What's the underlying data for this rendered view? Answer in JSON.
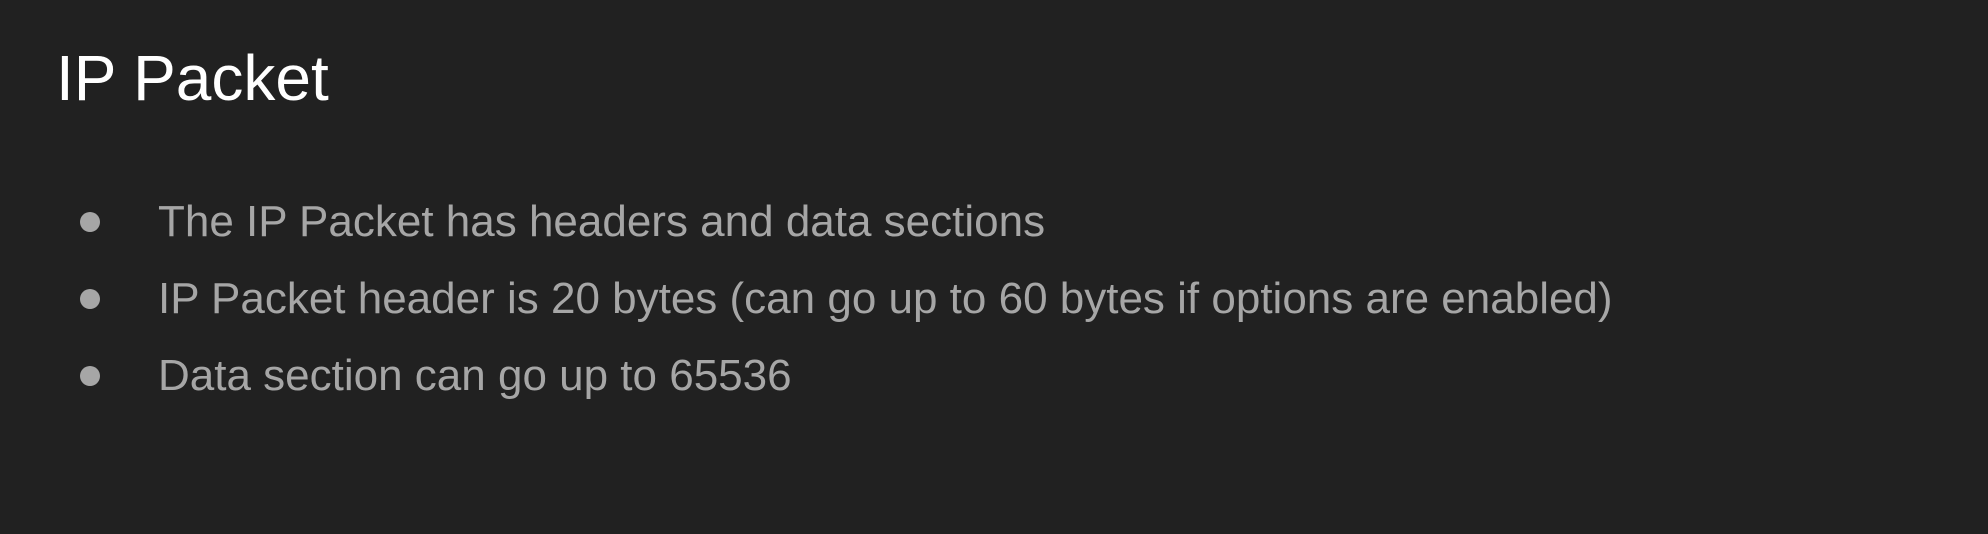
{
  "slide": {
    "title": "IP Packet",
    "bullets": [
      "The IP Packet has headers and data sections",
      "IP Packet header is 20 bytes (can go up to 60 bytes if options are enabled)",
      "Data section can go up to 65536"
    ]
  },
  "colors": {
    "background": "#212121",
    "title": "#ffffff",
    "bullet_text": "#a6a6a6",
    "bullet_dot": "#a6a6a6"
  }
}
